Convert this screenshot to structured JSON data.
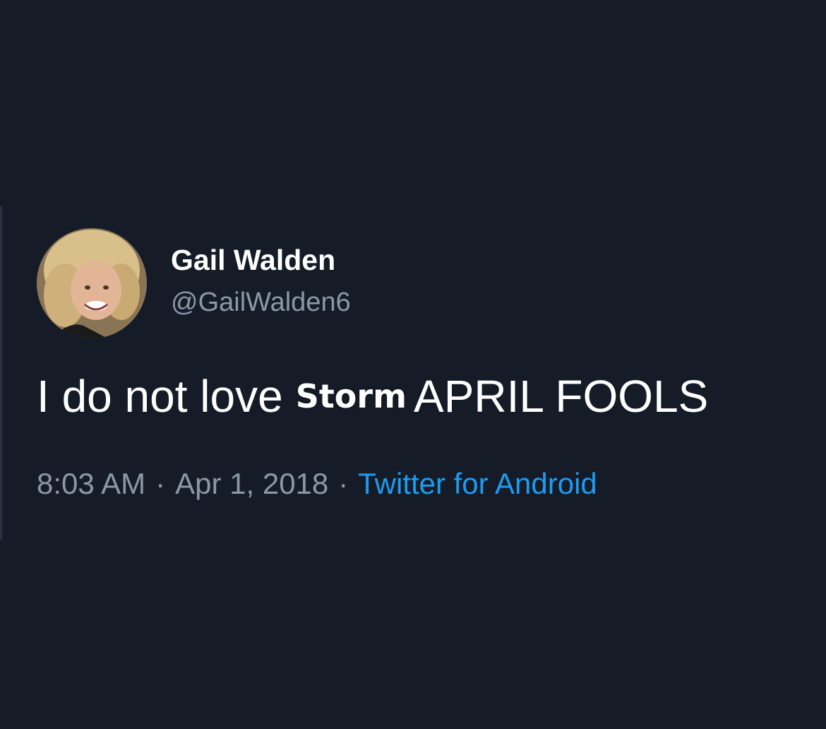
{
  "tweet": {
    "author_name": "Gail Walden",
    "author_handle": "@GailWalden6",
    "text_before": "I do not love",
    "overlay_word": "Storm",
    "text_after": "APRIL FOOLS",
    "time": "8:03 AM",
    "separator": "·",
    "date": "Apr 1, 2018",
    "source": "Twitter for Android"
  },
  "colors": {
    "background": "#151c28",
    "secondary_text": "#8b98a5",
    "link": "#1d9bf0"
  }
}
